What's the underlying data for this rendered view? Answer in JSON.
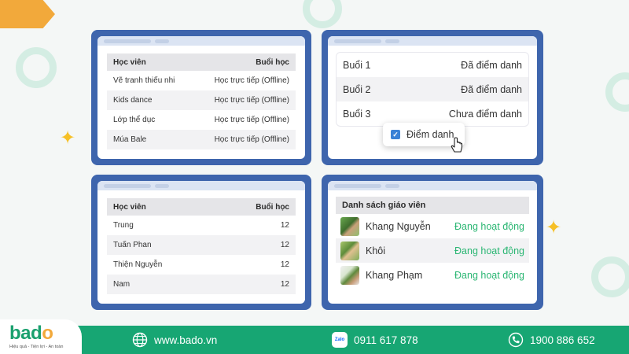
{
  "panel_students_sessions": {
    "headers": [
      "Học viên",
      "Buổi học"
    ],
    "rows": [
      {
        "name": "Vẽ tranh thiếu nhi",
        "mode": "Học trực tiếp (Offline)"
      },
      {
        "name": "Kids dance",
        "mode": "Học trực tiếp (Offline)"
      },
      {
        "name": "Lớp thể dục",
        "mode": "Học trực tiếp (Offline)"
      },
      {
        "name": "Múa Bale",
        "mode": "Học trực tiếp (Offline)"
      }
    ]
  },
  "panel_attendance": {
    "rows": [
      {
        "session": "Buổi 1",
        "status": "Đã điểm danh"
      },
      {
        "session": "Buổi 2",
        "status": "Đã điểm danh"
      },
      {
        "session": "Buổi 3",
        "status": "Chưa điểm danh"
      }
    ],
    "popup_label": "Điểm danh",
    "popup_checked": true
  },
  "panel_students_count": {
    "headers": [
      "Học viên",
      "Buổi học"
    ],
    "rows": [
      {
        "name": "Trung",
        "count": "12"
      },
      {
        "name": "Tuấn Phan",
        "count": "12"
      },
      {
        "name": "Thiện Nguyễn",
        "count": "12"
      },
      {
        "name": "Nam",
        "count": "12"
      }
    ]
  },
  "panel_teachers": {
    "title": "Danh sách giáo viên",
    "rows": [
      {
        "name": "Khang Nguyễn",
        "status": "Đang hoạt động"
      },
      {
        "name": "Khôi",
        "status": "Đang hoạt động"
      },
      {
        "name": "Khang Phạm",
        "status": "Đang hoạt động"
      }
    ]
  },
  "footer": {
    "logo": {
      "text_b": "b",
      "text_a": "a",
      "text_d": "d",
      "text_o": "o",
      "tagline": "Hiệu quả - Tiện lợi - An toàn"
    },
    "website": "www.bado.vn",
    "zalo_icon_label": "Zalo",
    "zalo_phone": "0911 617 878",
    "hotline": "1900 886 652"
  },
  "colors": {
    "panel_frame": "#3e65ad",
    "footer": "#17a673",
    "active_status": "#2bb673",
    "accent_orange": "#f2a93b",
    "checkbox": "#3b82d6"
  }
}
